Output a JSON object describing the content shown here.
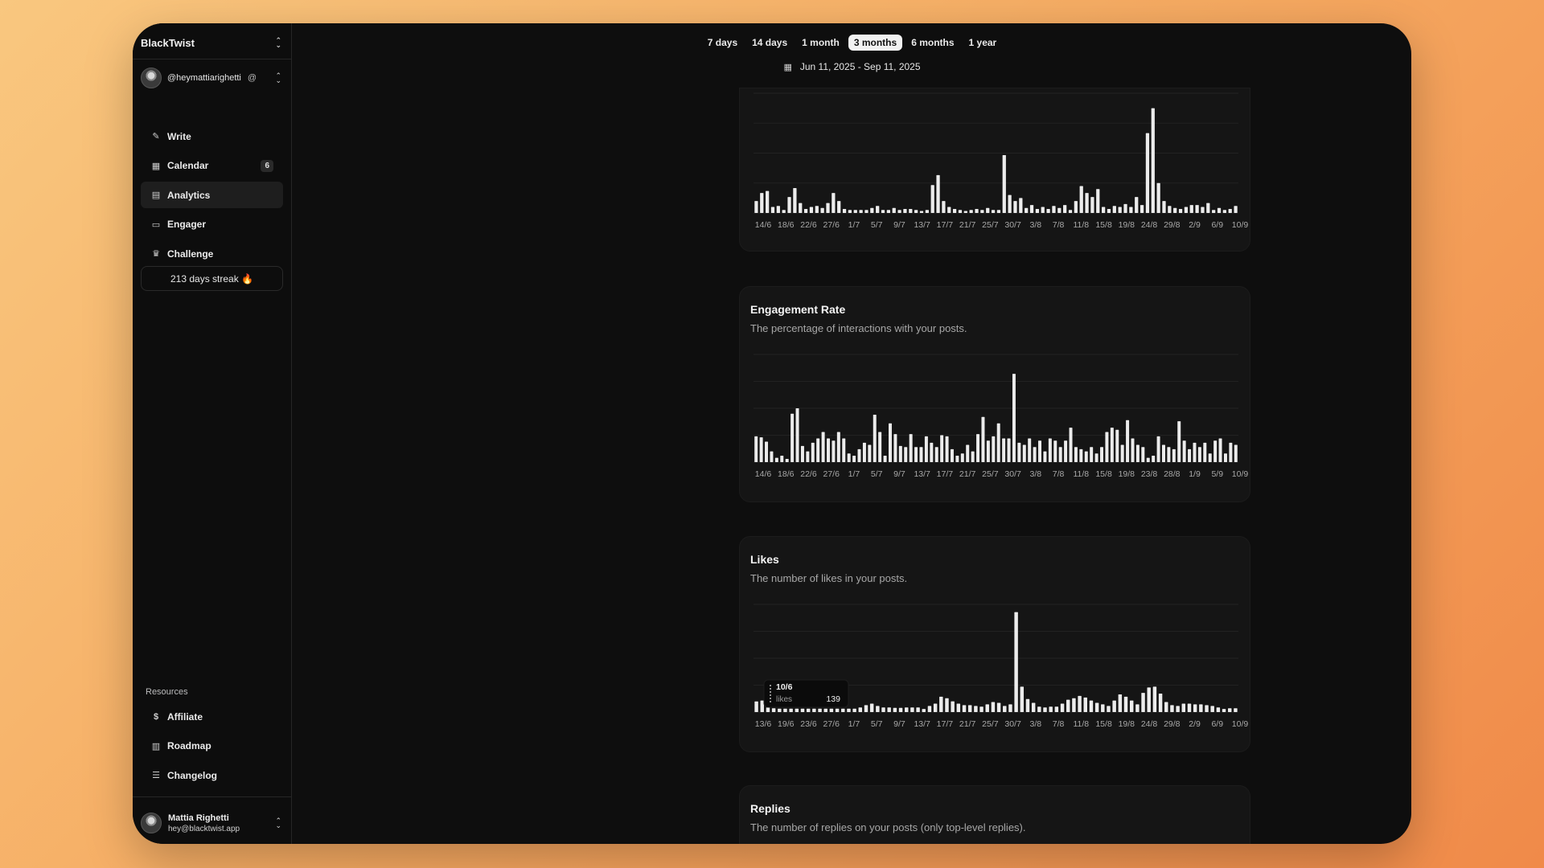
{
  "app": {
    "brand": "BlackTwist",
    "account_handle": "@heymattiarighetti",
    "nav": [
      {
        "label": "Write",
        "icon": "pencil-icon"
      },
      {
        "label": "Calendar",
        "icon": "calendar-icon",
        "badge": "6"
      },
      {
        "label": "Analytics",
        "icon": "analytics-icon",
        "active": true
      },
      {
        "label": "Engager",
        "icon": "chat-icon"
      },
      {
        "label": "Challenge",
        "icon": "trophy-icon"
      }
    ],
    "streak": "213 days streak 🔥",
    "resources_title": "Resources",
    "resources": [
      {
        "label": "Affiliate",
        "icon": "dollar-icon"
      },
      {
        "label": "Roadmap",
        "icon": "map-icon"
      },
      {
        "label": "Changelog",
        "icon": "list-icon"
      }
    ],
    "user": {
      "name": "Mattia Righetti",
      "email": "hey@blacktwist.app"
    }
  },
  "toolbar": {
    "ranges": [
      "7 days",
      "14 days",
      "1 month",
      "3 months",
      "6 months",
      "1 year"
    ],
    "selected_range": "3 months",
    "date_range": "Jun 11, 2025 - Sep 11, 2025"
  },
  "chart_data": [
    {
      "type": "bar",
      "title": "",
      "tick_labels": [
        "14/6",
        "18/6",
        "22/6",
        "27/6",
        "1/7",
        "5/7",
        "9/7",
        "13/7",
        "17/7",
        "21/7",
        "25/7",
        "30/7",
        "3/8",
        "7/8",
        "11/8",
        "15/8",
        "19/8",
        "24/8",
        "29/8",
        "2/9",
        "6/9",
        "10/9"
      ],
      "values": [
        12,
        20,
        22,
        6,
        7,
        3,
        16,
        25,
        10,
        4,
        6,
        7,
        5,
        10,
        20,
        12,
        4,
        3,
        3,
        3,
        3,
        5,
        7,
        3,
        3,
        5,
        3,
        4,
        4,
        3,
        2,
        3,
        28,
        38,
        12,
        6,
        4,
        3,
        2,
        3,
        4,
        3,
        5,
        3,
        3,
        58,
        18,
        12,
        15,
        5,
        8,
        4,
        6,
        4,
        7,
        5,
        8,
        3,
        12,
        27,
        20,
        16,
        24,
        6,
        4,
        7,
        6,
        9,
        6,
        16,
        8,
        80,
        105,
        30,
        12,
        7,
        5,
        4,
        6,
        8,
        8,
        6,
        10,
        3,
        5,
        3,
        4,
        7
      ],
      "ylim": [
        0,
        120
      ]
    },
    {
      "type": "bar",
      "title": "Engagement Rate",
      "subtitle": "The percentage of interactions with your posts.",
      "tick_labels": [
        "14/6",
        "18/6",
        "22/6",
        "27/6",
        "1/7",
        "5/7",
        "9/7",
        "13/7",
        "17/7",
        "21/7",
        "25/7",
        "30/7",
        "3/8",
        "7/8",
        "11/8",
        "15/8",
        "19/8",
        "23/8",
        "28/8",
        "1/9",
        "5/9",
        "10/9"
      ],
      "values": [
        24,
        23,
        19,
        10,
        4,
        6,
        3,
        45,
        50,
        15,
        10,
        18,
        22,
        28,
        22,
        20,
        28,
        22,
        8,
        6,
        12,
        18,
        16,
        44,
        28,
        6,
        36,
        26,
        15,
        14,
        26,
        14,
        14,
        24,
        18,
        14,
        25,
        24,
        12,
        6,
        8,
        16,
        10,
        26,
        42,
        20,
        24,
        36,
        22,
        22,
        82,
        18,
        16,
        22,
        14,
        20,
        10,
        22,
        20,
        14,
        20,
        32,
        14,
        12,
        10,
        14,
        8,
        14,
        28,
        32,
        30,
        16,
        39,
        22,
        16,
        14,
        4,
        6,
        24,
        16,
        14,
        12,
        38,
        20,
        12,
        18,
        14,
        18,
        8,
        20,
        22,
        8,
        18,
        16
      ],
      "ylim": [
        0,
        100
      ]
    },
    {
      "type": "bar",
      "title": "Likes",
      "subtitle": "The number of likes in your posts.",
      "tick_labels": [
        "13/6",
        "19/6",
        "23/6",
        "27/6",
        "1/7",
        "5/7",
        "9/7",
        "13/7",
        "17/7",
        "21/7",
        "25/7",
        "30/7",
        "3/8",
        "7/8",
        "11/8",
        "15/8",
        "19/8",
        "24/8",
        "29/8",
        "2/9",
        "6/9",
        "10/9"
      ],
      "values": [
        139,
        150,
        60,
        50,
        45,
        45,
        45,
        45,
        45,
        45,
        45,
        45,
        45,
        45,
        45,
        45,
        45,
        45,
        60,
        90,
        110,
        80,
        60,
        60,
        55,
        55,
        60,
        60,
        60,
        40,
        80,
        110,
        200,
        180,
        140,
        110,
        90,
        90,
        80,
        70,
        100,
        130,
        120,
        80,
        100,
        1300,
        330,
        170,
        120,
        70,
        60,
        70,
        70,
        110,
        160,
        180,
        210,
        190,
        150,
        120,
        100,
        80,
        150,
        230,
        200,
        150,
        100,
        250,
        320,
        330,
        240,
        130,
        90,
        80,
        110,
        110,
        100,
        100,
        90,
        80,
        60,
        40,
        50,
        50
      ],
      "ylim": [
        0,
        1400
      ],
      "tooltip": {
        "date": "10/6",
        "label": "likes",
        "value": "139"
      }
    },
    {
      "type": "bar",
      "title": "Replies",
      "subtitle": "The number of replies on your posts (only top-level replies)."
    }
  ]
}
